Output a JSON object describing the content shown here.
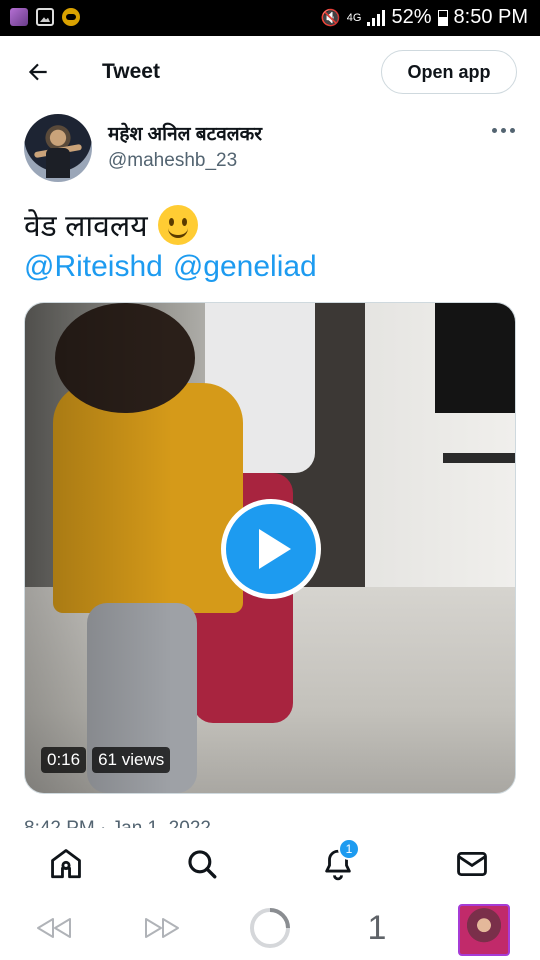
{
  "status_bar": {
    "network": "4G",
    "battery": "52%",
    "time": "8:50 PM"
  },
  "header": {
    "title": "Tweet",
    "open_app": "Open app"
  },
  "tweet": {
    "author_name": "महेश अनिल बटवलकर",
    "author_handle": "@maheshb_23",
    "text": "वेड लावलय",
    "mentions": [
      "@Riteishd",
      "@geneliad"
    ],
    "video": {
      "duration": "0:16",
      "views": "61 views"
    },
    "timestamp": "8:42 PM · Jan 1, 2022"
  },
  "bottom_nav": {
    "notification_count": "1"
  },
  "browser_bar": {
    "tab_count": "1"
  },
  "colors": {
    "accent": "#1d9bf0",
    "text_primary": "#0f1419",
    "text_secondary": "#536471",
    "border": "#cfd9de"
  }
}
